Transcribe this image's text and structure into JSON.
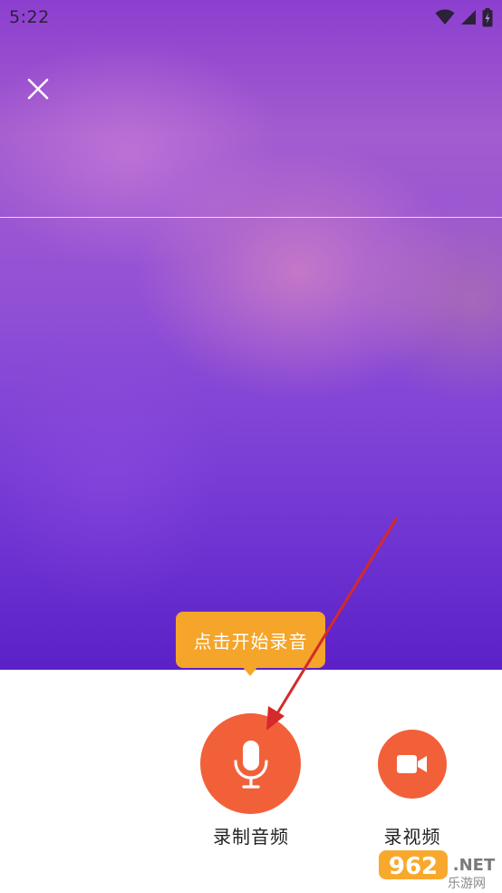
{
  "status_bar": {
    "time": "5:22",
    "icons": [
      "wifi-icon",
      "signal-icon",
      "battery-icon"
    ]
  },
  "top_bar": {
    "close_icon": "close-icon"
  },
  "tooltip": {
    "text": "点击开始录音",
    "color": "#f4a52a"
  },
  "actions": {
    "record_audio": {
      "label": "录制音频",
      "icon": "microphone-icon"
    },
    "record_video": {
      "label": "录视频",
      "icon": "video-camera-icon"
    }
  },
  "annotation": {
    "arrow_color": "#d42a2a"
  },
  "watermark": {
    "number": "962",
    "suffix": ".NET",
    "subtitle": "乐游网"
  },
  "colors": {
    "accent": "#f2603a",
    "bg_top": "#8c3fcf",
    "bg_bottom": "#5b21c8"
  }
}
